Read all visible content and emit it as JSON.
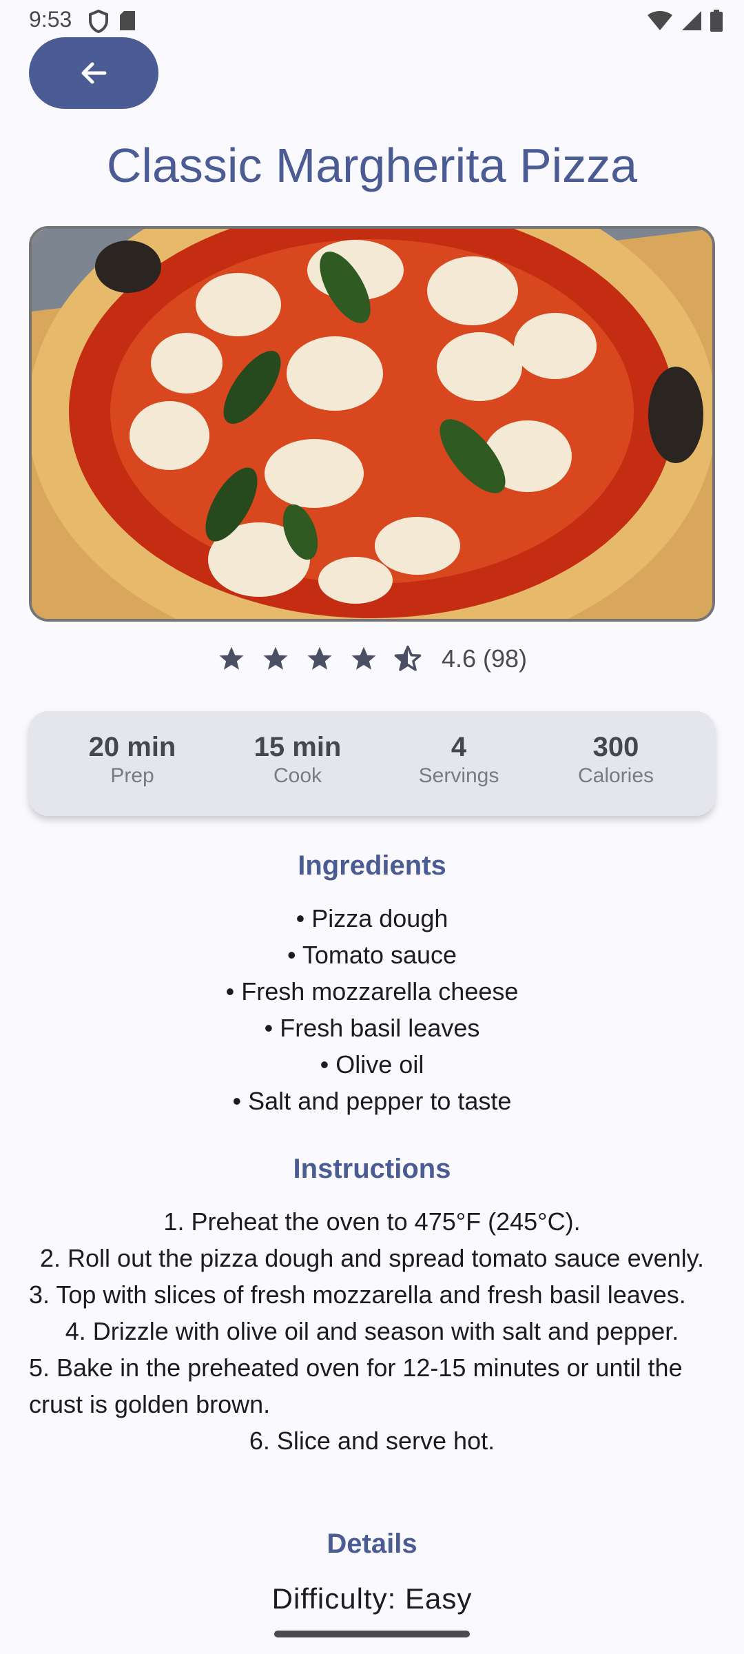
{
  "status_bar": {
    "time": "9:53"
  },
  "header": {
    "back_icon": "arrow-left-icon"
  },
  "recipe": {
    "title": "Classic Margherita Pizza",
    "rating": {
      "value": 4.6,
      "text": "4.6 (98)",
      "stars_filled": 4.5
    },
    "stats": [
      {
        "value": "20 min",
        "label": "Prep"
      },
      {
        "value": "15 min",
        "label": "Cook"
      },
      {
        "value": "4",
        "label": "Servings"
      },
      {
        "value": "300",
        "label": "Calories"
      }
    ],
    "ingredients_heading": "Ingredients",
    "ingredients": [
      "• Pizza dough",
      "• Tomato sauce",
      "• Fresh mozzarella cheese",
      "• Fresh basil leaves",
      "• Olive oil",
      "• Salt and pepper to taste"
    ],
    "instructions_heading": "Instructions",
    "instructions": [
      "1. Preheat the oven to 475°F (245°C).",
      "2. Roll out the pizza dough and spread tomato sauce evenly.",
      "3. Top with slices of fresh mozzarella and fresh basil leaves.",
      "4. Drizzle with olive oil and season with salt and pepper.",
      "5. Bake in the preheated oven for 12-15 minutes or until the crust is golden brown.",
      "6. Slice and serve hot."
    ],
    "details_heading": "Details",
    "difficulty": "Difficulty: Easy"
  },
  "colors": {
    "primary": "#4a5c93",
    "card": "#e5e5ec",
    "background": "#faf9fd"
  }
}
